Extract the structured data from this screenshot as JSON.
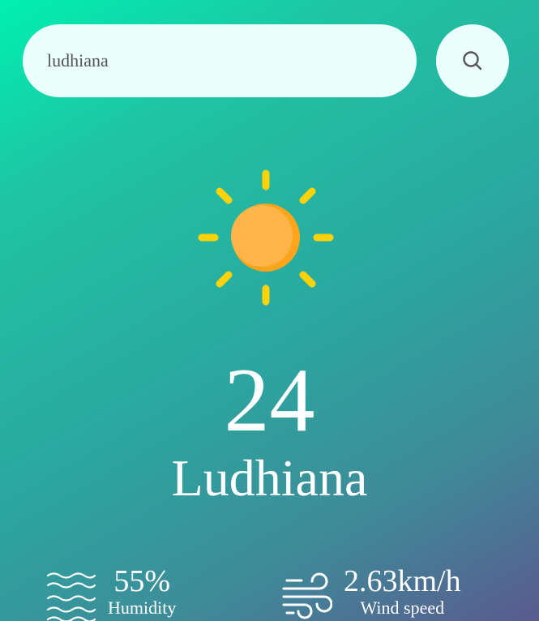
{
  "search": {
    "value": "ludhiana"
  },
  "icons": {
    "search": "search-icon",
    "weather": "sun-icon",
    "humidity": "water-waves-icon",
    "wind": "wind-icon"
  },
  "weather": {
    "temperature": "24",
    "city": "Ludhiana"
  },
  "details": {
    "humidity_value": "55%",
    "humidity_label": "Humidity",
    "wind_value": "2.63km/h",
    "wind_label": "Wind speed"
  },
  "colors": {
    "gradient_start": "#00f0b0",
    "gradient_end": "#5a5a8e",
    "input_background": "#ebfffc",
    "sun_core": "#ffb23f",
    "sun_rays": "#ffd20a"
  }
}
